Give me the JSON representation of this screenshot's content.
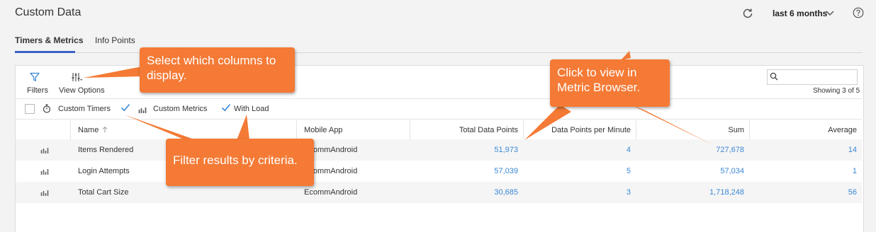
{
  "header": {
    "title": "Custom Data",
    "time_range": "last 6 months"
  },
  "tabs": [
    {
      "label": "Timers & Metrics",
      "active": true
    },
    {
      "label": "Info Points",
      "active": false
    }
  ],
  "toolbar": {
    "filters_label": "Filters",
    "view_options_label": "View Options",
    "search_value": "",
    "showing": "Showing 3 of 5"
  },
  "filters": [
    {
      "label": "Custom Timers",
      "checked": false,
      "icon": "stopwatch-icon"
    },
    {
      "label": "Custom Metrics",
      "checked": true,
      "icon": "bar-chart-icon"
    },
    {
      "label": "With Load",
      "checked": true
    }
  ],
  "table": {
    "columns": [
      "Name",
      "Mobile App",
      "Total Data Points",
      "Data Points per Minute",
      "Sum",
      "Average"
    ],
    "sort": {
      "column": "Name",
      "direction": "asc"
    },
    "rows": [
      {
        "name": "Items Rendered",
        "app": "EcommAndroid",
        "total": "51,973",
        "per_minute": "4",
        "sum": "727,678",
        "average": "14"
      },
      {
        "name": "Login Attempts",
        "app": "EcommAndroid",
        "total": "57,039",
        "per_minute": "5",
        "sum": "57,034",
        "average": "1"
      },
      {
        "name": "Total Cart Size",
        "app": "EcommAndroid",
        "total": "30,685",
        "per_minute": "3",
        "sum": "1,718,248",
        "average": "56"
      }
    ]
  },
  "callouts": {
    "columns": "Select which columns to display.",
    "metric_browser": "Click to view in Metric Browser.",
    "filter": "Filter results by criteria."
  },
  "colors": {
    "accent": "#3b63c5",
    "link": "#3a87d6",
    "callout": "#f47a35"
  }
}
